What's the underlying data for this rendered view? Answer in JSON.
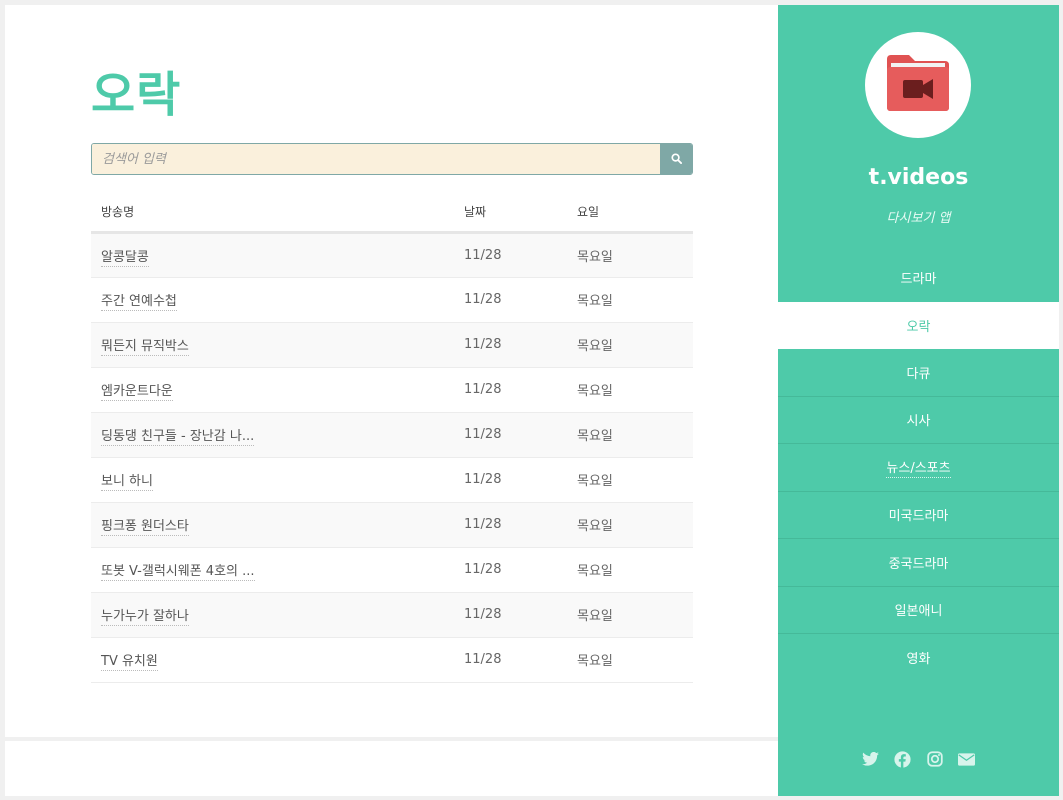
{
  "main": {
    "title": "오락",
    "search": {
      "placeholder": "검색어 입력",
      "value": ""
    },
    "table": {
      "headers": {
        "name": "방송명",
        "date": "날짜",
        "day": "요일"
      },
      "rows": [
        {
          "name": "알콩달콩",
          "date": "11/28",
          "day": "목요일"
        },
        {
          "name": "주간 연예수첩",
          "date": "11/28",
          "day": "목요일"
        },
        {
          "name": "뭐든지 뮤직박스",
          "date": "11/28",
          "day": "목요일"
        },
        {
          "name": "엠카운트다운",
          "date": "11/28",
          "day": "목요일"
        },
        {
          "name": "딩동댕 친구들 - 장난감 나...",
          "date": "11/28",
          "day": "목요일"
        },
        {
          "name": "보니 하니",
          "date": "11/28",
          "day": "목요일"
        },
        {
          "name": "핑크퐁 원더스타",
          "date": "11/28",
          "day": "목요일"
        },
        {
          "name": "또봇 V-갤럭시웨폰 4호의 ...",
          "date": "11/28",
          "day": "목요일"
        },
        {
          "name": "누가누가 잘하나",
          "date": "11/28",
          "day": "목요일"
        },
        {
          "name": "TV 유치원",
          "date": "11/28",
          "day": "목요일"
        }
      ]
    }
  },
  "sidebar": {
    "logo_icon": "video-folder-icon",
    "brand": "t.videos",
    "tagline": "다시보기 앱",
    "nav": [
      {
        "label": "드라마",
        "active": false
      },
      {
        "label": "오락",
        "active": true
      },
      {
        "label": "다큐",
        "active": false
      },
      {
        "label": "시사",
        "active": false
      },
      {
        "label": "뉴스/스포츠",
        "active": false
      },
      {
        "label": "미국드라마",
        "active": false
      },
      {
        "label": "중국드라마",
        "active": false
      },
      {
        "label": "일본애니",
        "active": false
      },
      {
        "label": "영화",
        "active": false
      }
    ],
    "social": [
      "twitter-icon",
      "facebook-icon",
      "instagram-icon",
      "email-icon"
    ]
  },
  "colors": {
    "accent": "#4ecaa9",
    "search_bg": "#faf0dc",
    "search_button": "#7fa8a6",
    "logo_red": "#e05252"
  }
}
